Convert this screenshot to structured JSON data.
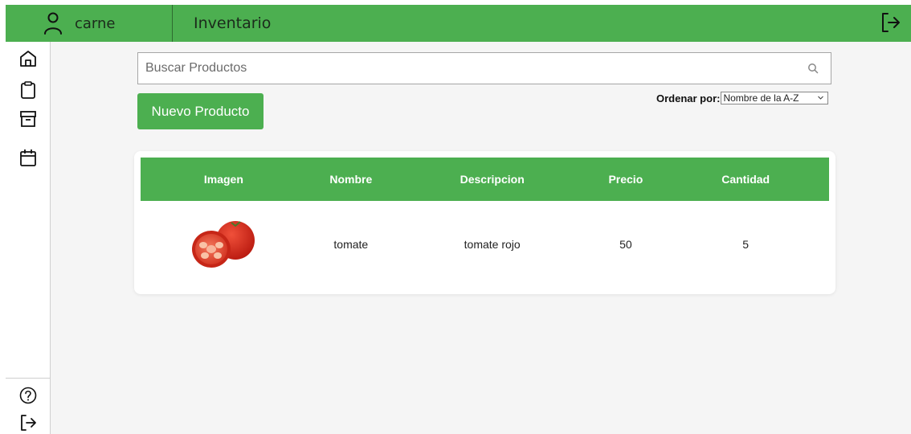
{
  "header": {
    "username": "carne",
    "title": "Inventario"
  },
  "icons": {
    "user": "user-icon",
    "logout": "logout-icon",
    "home": "home-icon",
    "clipboard": "clipboard-icon",
    "archive": "archive-icon",
    "calendar": "calendar-icon",
    "help": "help-icon",
    "search": "search-icon"
  },
  "colors": {
    "primary": "#4caf50",
    "background": "#f5f5f5"
  },
  "search": {
    "placeholder": "Buscar Productos",
    "value": ""
  },
  "toolbar": {
    "new_product_label": "Nuevo Producto",
    "sort_label": "Ordenar por:",
    "sort_selected": "Nombre de la A-Z"
  },
  "table": {
    "columns": [
      "Imagen",
      "Nombre",
      "Descripcion",
      "Precio",
      "Cantidad"
    ],
    "rows": [
      {
        "image": "tomato-image",
        "nombre": "tomate",
        "descripcion": "tomate rojo",
        "precio": "50",
        "cantidad": "5"
      }
    ]
  }
}
